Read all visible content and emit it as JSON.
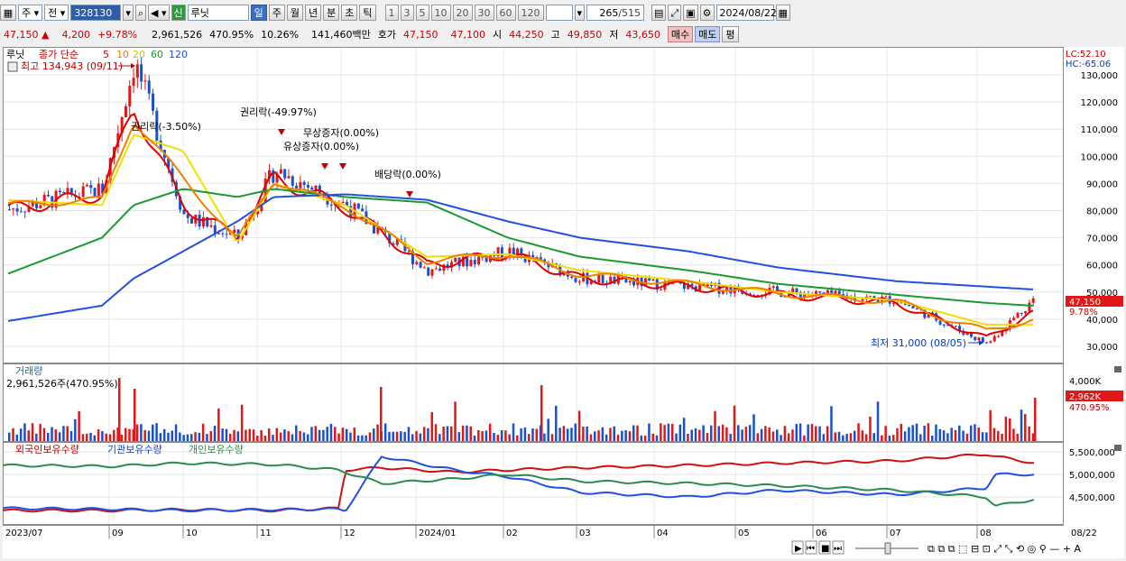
{
  "toolbar": {
    "type_select": "주",
    "type2_select": "전",
    "code": "328130",
    "name": "루닛",
    "new_badge": "신",
    "period_tabs": [
      "일",
      "주",
      "월",
      "년",
      "분",
      "초",
      "틱"
    ],
    "active_period": "일",
    "interval_buttons": [
      "1",
      "3",
      "5",
      "10",
      "20",
      "30",
      "60",
      "120"
    ],
    "count": "265",
    "total": "/515",
    "date": "2024/08/22"
  },
  "quote": {
    "price": "47,150",
    "change_arrow": "▲",
    "change": "4,200",
    "change_rate": "+9.78%",
    "volume": "2,961,526",
    "volume_rate": "470.95%",
    "turnover_rate": "10.26%",
    "amount": "141,460백만",
    "bid_label": "호가",
    "ask": "47,150",
    "bid": "47,100",
    "open_label": "시",
    "open": "44,250",
    "high_label": "고",
    "high": "49,850",
    "low_label": "저",
    "low": "43,650",
    "buy_button": "매수",
    "sell_button": "매도",
    "eval_button": "평"
  },
  "chart": {
    "legend_name": "루닛",
    "legend_ma": "종가 단순",
    "ma_periods": [
      "5",
      "10",
      "20",
      "60",
      "120"
    ],
    "ma_colors": [
      "#e00000",
      "#f08000",
      "#f0e000",
      "#1a9a30",
      "#2050e0"
    ],
    "lc": "LC:52.10",
    "hc": "HC:-65.06",
    "price_ticks": [
      "130,000",
      "120,000",
      "110,000",
      "100,000",
      "90,000",
      "80,000",
      "70,000",
      "60,000",
      "50,000",
      "40,000",
      "30,000"
    ],
    "current_price_label": "47,150",
    "current_rate_label": "9.78%",
    "high_annotation": "최고 134,943 (09/11)",
    "low_annotation": "최저 31,000 (08/05)",
    "events": [
      "권리락(-3.50%)",
      "권리락(-49.97%)",
      "무상증자(0.00%)",
      "유상증자(0.00%)",
      "배당락(0.00%)"
    ],
    "volume_title": "거래량",
    "volume_value": "2,961,526주(470.95%)",
    "volume_ticks": [
      "4,000K"
    ],
    "volume_current": "2,962K",
    "volume_rate": "470.95%",
    "holdings_legend": [
      "외국인보유수량",
      "기관보유수량",
      "개인보유수량"
    ],
    "holdings_ticks": [
      "5,500,000",
      "5,000,000",
      "4,500,000"
    ],
    "x_labels": [
      "2023/07",
      "09",
      "10",
      "11",
      "12",
      "2024/01",
      "02",
      "03",
      "04",
      "05",
      "06",
      "07",
      "08"
    ],
    "x_last_label": "08/22"
  },
  "chart_data": {
    "type": "candlestick",
    "series": [
      {
        "name": "루닛",
        "kind": "close",
        "x": [
          "2023/07",
          "2023/09",
          "2023/09/11",
          "2023/10",
          "2023/11",
          "2023/12",
          "2024/01",
          "2024/02",
          "2024/03",
          "2024/04",
          "2024/05",
          "2024/06",
          "2024/07",
          "2024/08/05",
          "2024/08/22"
        ],
        "values": [
          80000,
          88000,
          134943,
          78000,
          70000,
          95000,
          82000,
          58000,
          65000,
          55000,
          52000,
          50000,
          47000,
          31000,
          47150
        ]
      },
      {
        "name": "5",
        "values": [
          80000,
          86000,
          118000,
          82000,
          70000,
          92000,
          81000,
          60000,
          64000,
          55000,
          52000,
          49000,
          46000,
          33000,
          42000
        ]
      },
      {
        "name": "20",
        "values": [
          84000,
          82000,
          108000,
          102000,
          68000,
          90000,
          82000,
          63000,
          64000,
          58000,
          54000,
          50000,
          47000,
          38000,
          38000
        ]
      },
      {
        "name": "60",
        "values": [
          56000,
          70000,
          82000,
          88000,
          85000,
          88000,
          85000,
          83000,
          70000,
          63000,
          58000,
          53000,
          49000,
          46000,
          45000
        ]
      },
      {
        "name": "120",
        "values": [
          39000,
          45000,
          55000,
          65000,
          76000,
          85000,
          86000,
          84000,
          76000,
          70000,
          65000,
          59000,
          54000,
          52000,
          51000
        ]
      }
    ],
    "ylim": [
      25000,
      140000
    ]
  }
}
